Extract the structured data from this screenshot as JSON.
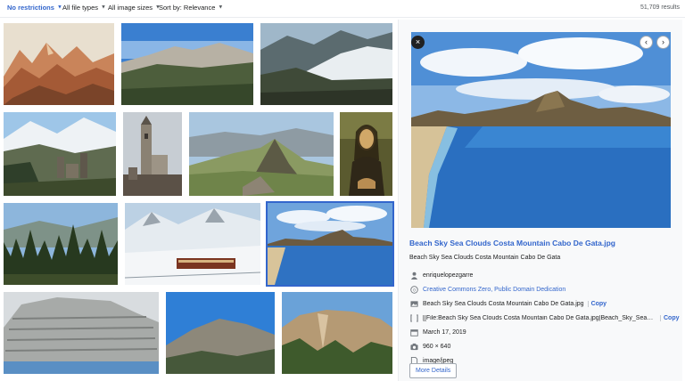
{
  "filters": {
    "restrictions": "No restrictions",
    "file_types": "All file types",
    "image_sizes": "All image sizes",
    "sort": "Sort by: Relevance",
    "results": "51,709 results"
  },
  "grid": {
    "items": [
      {
        "name": "painted-mountain-landscape"
      },
      {
        "name": "mountain-valley-panorama"
      },
      {
        "name": "snowy-mountain-ridge"
      },
      {
        "name": "castle-ruins-mountains"
      },
      {
        "name": "stone-tower-building"
      },
      {
        "name": "mountain-peak-valley"
      },
      {
        "name": "mona-lisa-painting"
      },
      {
        "name": "pine-forest-mountains"
      },
      {
        "name": "train-snowy-mountains"
      },
      {
        "name": "beach-sky-sea-clouds"
      },
      {
        "name": "layered-cliff-mountain"
      },
      {
        "name": "rocky-mountain-desert"
      },
      {
        "name": "rock-cliff-forest"
      }
    ]
  },
  "detail": {
    "title": "Beach Sky Sea Clouds Costa Mountain Cabo De Gata.jpg",
    "description": "Beach Sky Sea Clouds Costa Mountain Cabo De Gata",
    "author": "enriquelopezgarre",
    "license": "Creative Commons Zero, Public Domain Dedication",
    "filename": "Beach Sky Sea Clouds Costa Mountain Cabo De Gata.jpg",
    "wikitext": "[[File:Beach Sky Sea Clouds Costa Mountain Cabo De Gata.jpg|Beach_Sky_Sea_Clouds_...",
    "copy_label": "Copy",
    "date": "March 17, 2019",
    "dimensions": "960 × 640",
    "mime": "image/jpeg",
    "more_details": "More Details",
    "close_glyph": "×",
    "prev_glyph": "‹",
    "next_glyph": "›"
  },
  "colors": {
    "link": "#3366cc",
    "selected_outline": "#3366cc",
    "panel_bg": "#f8f9fa",
    "text": "#202122"
  }
}
